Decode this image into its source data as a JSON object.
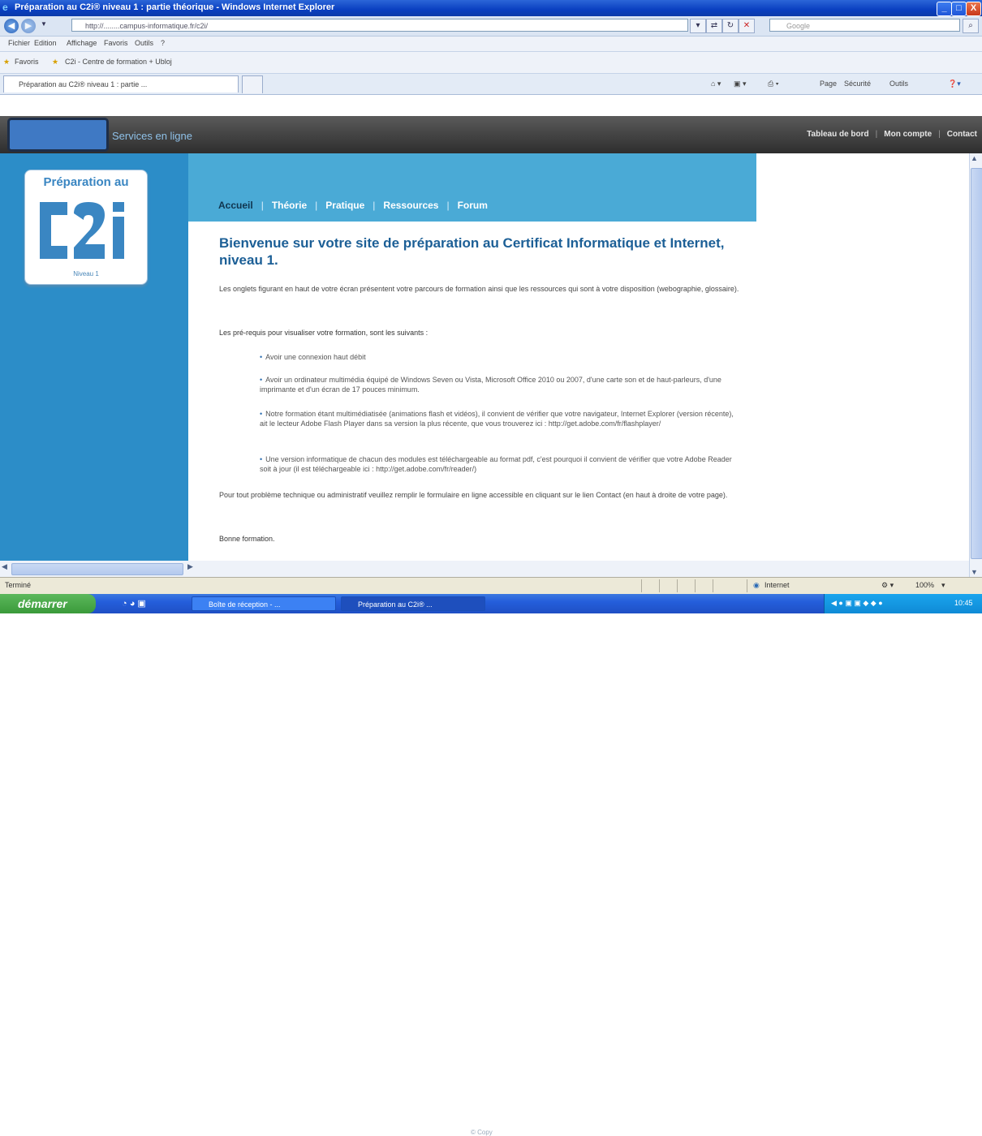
{
  "window": {
    "title": "Préparation au C2i® niveau 1 : partie théorique - Windows Internet Explorer",
    "controls": [
      "_",
      "□",
      "X"
    ]
  },
  "browser": {
    "address": "http://........campus-informatique.fr/c2i/",
    "search_placeholder": "Google",
    "menu": [
      "Fichier",
      "Edition",
      "Affichage",
      "Favoris",
      "Outils",
      "?"
    ],
    "favorites": [
      "Favoris",
      "C2i - Centre de formation + Ubloj"
    ],
    "tab_title": "Préparation au C2i® niveau 1 : partie ...",
    "command_bar": [
      "Page",
      "Sécurité",
      "Outils"
    ]
  },
  "site": {
    "service_label": "Services en ligne",
    "top_links": [
      "Tableau de bord",
      "Mon compte",
      "Contact"
    ],
    "logo": {
      "top_text": "Préparation au",
      "mark": "C2i",
      "level": "Niveau 1"
    },
    "nav": [
      "Accueil",
      "Théorie",
      "Pratique",
      "Ressources",
      "Forum"
    ],
    "active_nav": "Accueil"
  },
  "content": {
    "title": "Bienvenue sur votre site de préparation au Certificat Informatique et Internet, niveau 1.",
    "intro": "Les onglets figurant en haut de votre écran présentent votre parcours de formation ainsi que les ressources qui sont à votre disposition (webographie, glossaire).",
    "prereq_heading": "Les pré-requis pour visualiser votre formation, sont les suivants :",
    "bullets": [
      "Avoir une connexion haut débit",
      "Avoir un ordinateur multimédia équipé de Windows Seven ou Vista, Microsoft Office 2010 ou 2007, d'une carte son et de haut-parleurs, d'une imprimante et d'un écran de 17 pouces minimum.",
      "Notre formation étant multimédiatisée (animations flash et vidéos), il convient de vérifier que votre navigateur, Internet Explorer (version récente), ait le lecteur Adobe Flash Player dans sa version la plus récente, que vous trouverez ici : http://get.adobe.com/fr/flashplayer/",
      "Une version informatique de chacun des modules est téléchargeable au format pdf, c'est pourquoi il convient de vérifier que votre Adobe Reader soit à jour (il est téléchargeable ici : http://get.adobe.com/fr/reader/)"
    ],
    "reader_link": "http://get.adobe.com/fr/reader/",
    "support": "Pour tout problème technique ou administratif veuillez remplir le formulaire en ligne accessible en cliquant sur le lien Contact (en haut à droite de votre page).",
    "closing": "Bonne formation.",
    "footer_cut": "© Copy"
  },
  "statusbar": {
    "left": "Terminé",
    "zone": "Internet",
    "zoom": "100%"
  },
  "taskbar": {
    "start": "démarrer",
    "tasks": [
      "Boîte de réception - ...",
      "Préparation au C2i® ..."
    ],
    "clock": "10:45"
  }
}
